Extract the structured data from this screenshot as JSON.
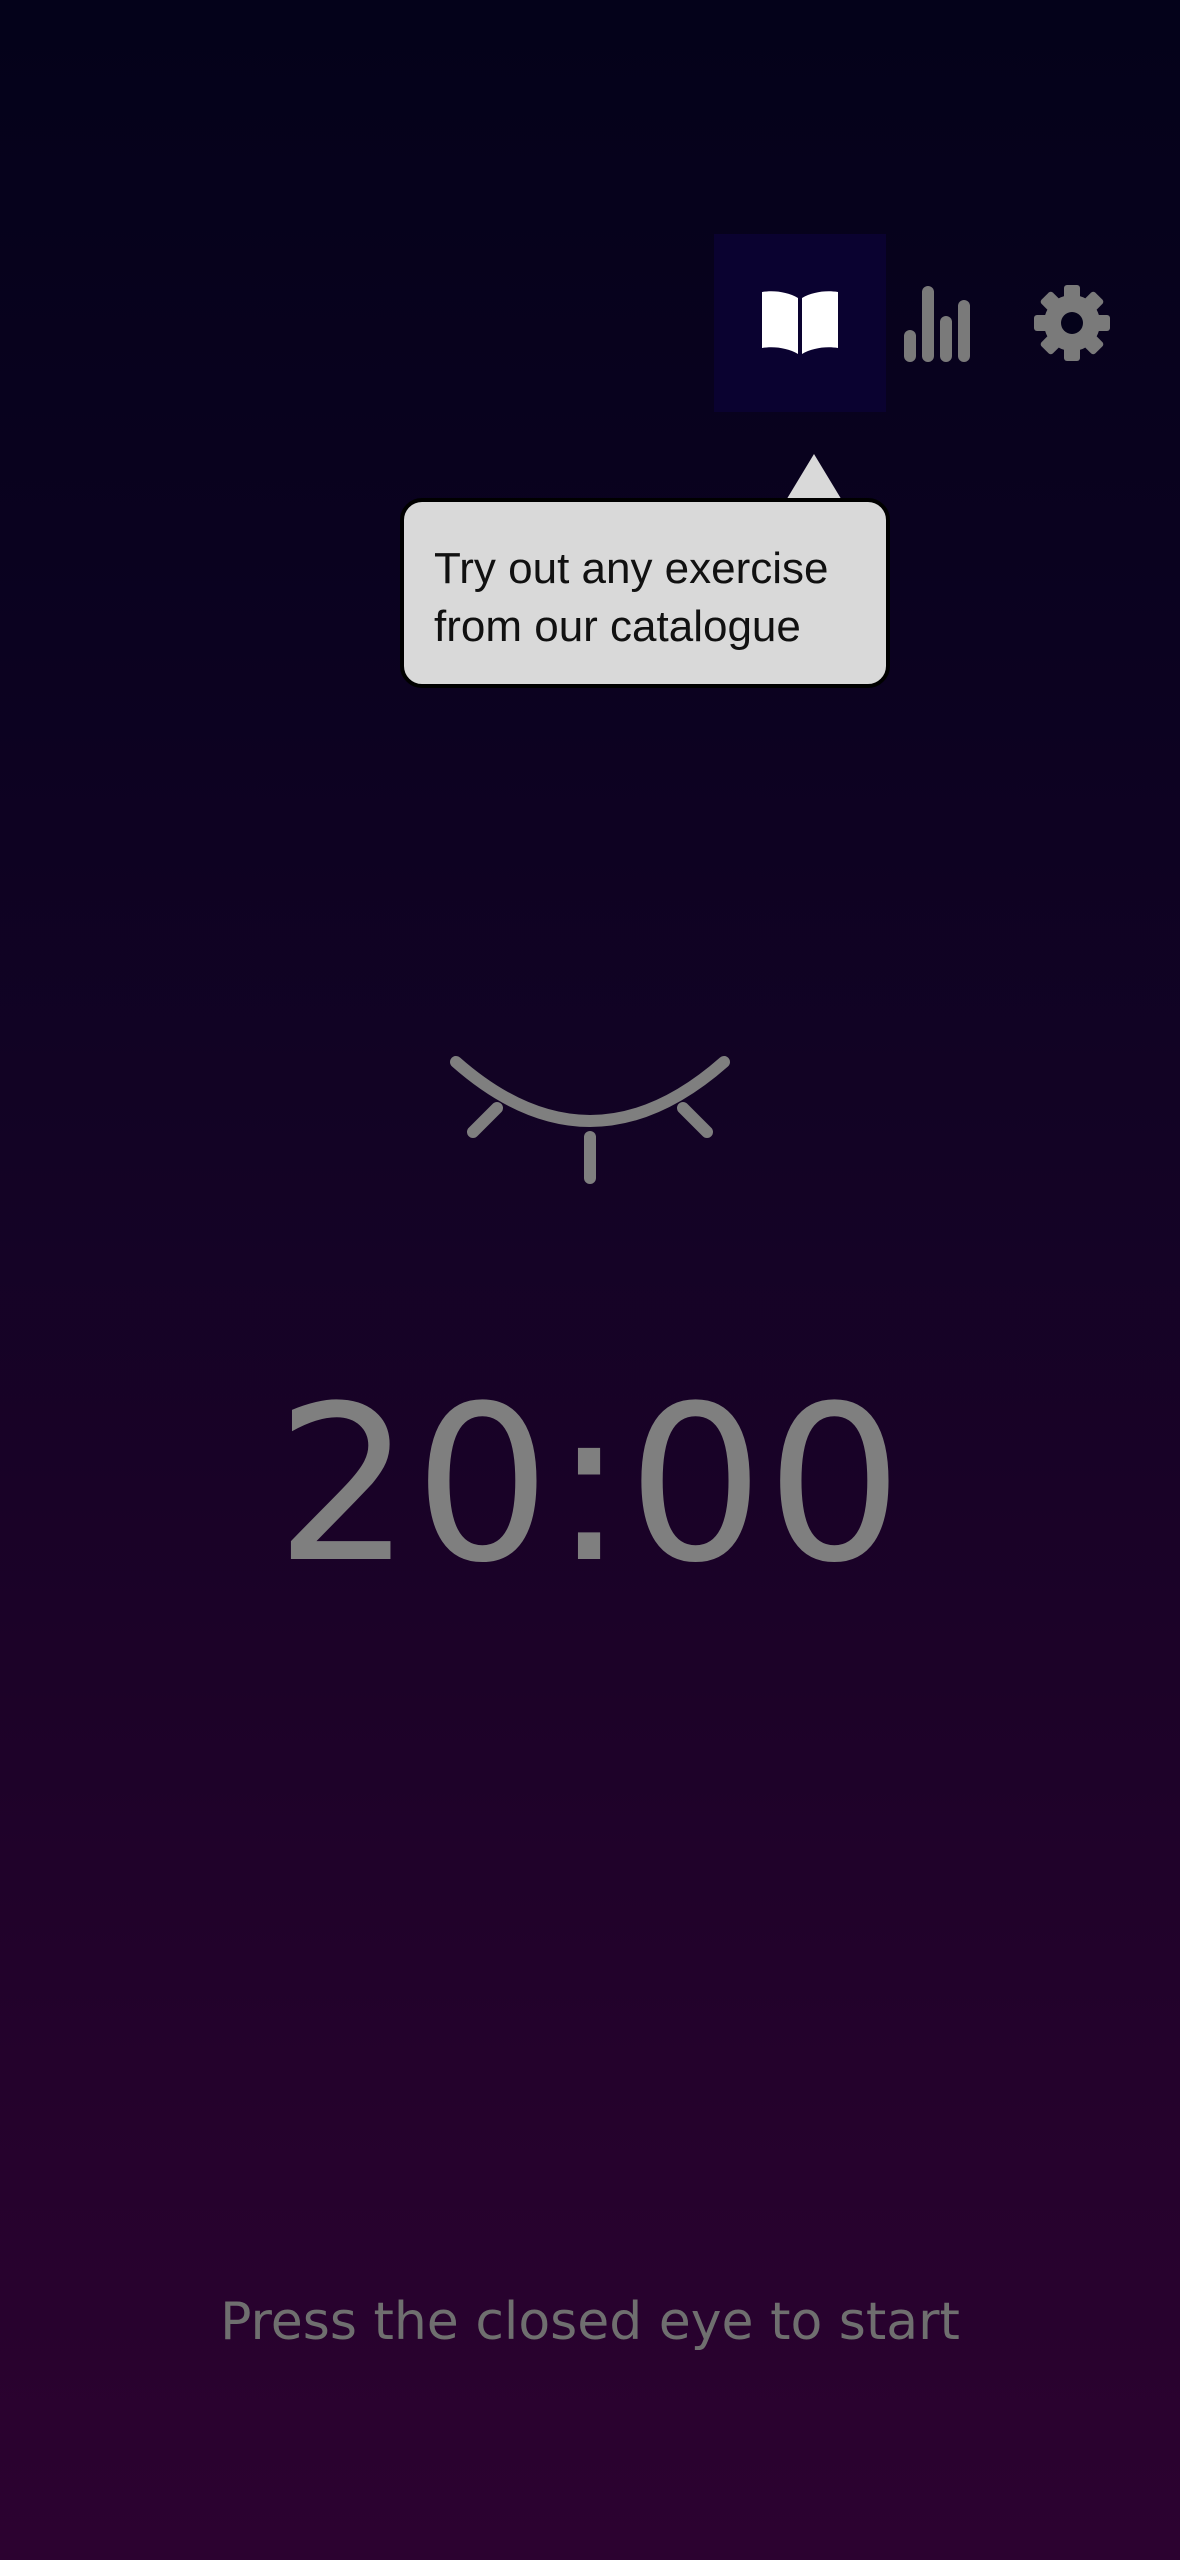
{
  "toolbar": {
    "items": [
      {
        "icon": "book-icon",
        "active": true
      },
      {
        "icon": "bar-chart-icon",
        "active": false
      },
      {
        "icon": "gear-icon",
        "active": false
      }
    ]
  },
  "tooltip": {
    "text": "Try out any exercise\nfrom our catalogue"
  },
  "main": {
    "eye_icon": "closed-eye-icon",
    "timer": "20:00",
    "hint": "Press the closed eye to start"
  },
  "colors": {
    "background_top": "#04021a",
    "background_bottom": "#2c0230",
    "active_button_bg": "#0a0230",
    "icon_active": "#ffffff",
    "icon_inactive": "#7a7a7a",
    "tooltip_bg": "#d9d9d9"
  }
}
